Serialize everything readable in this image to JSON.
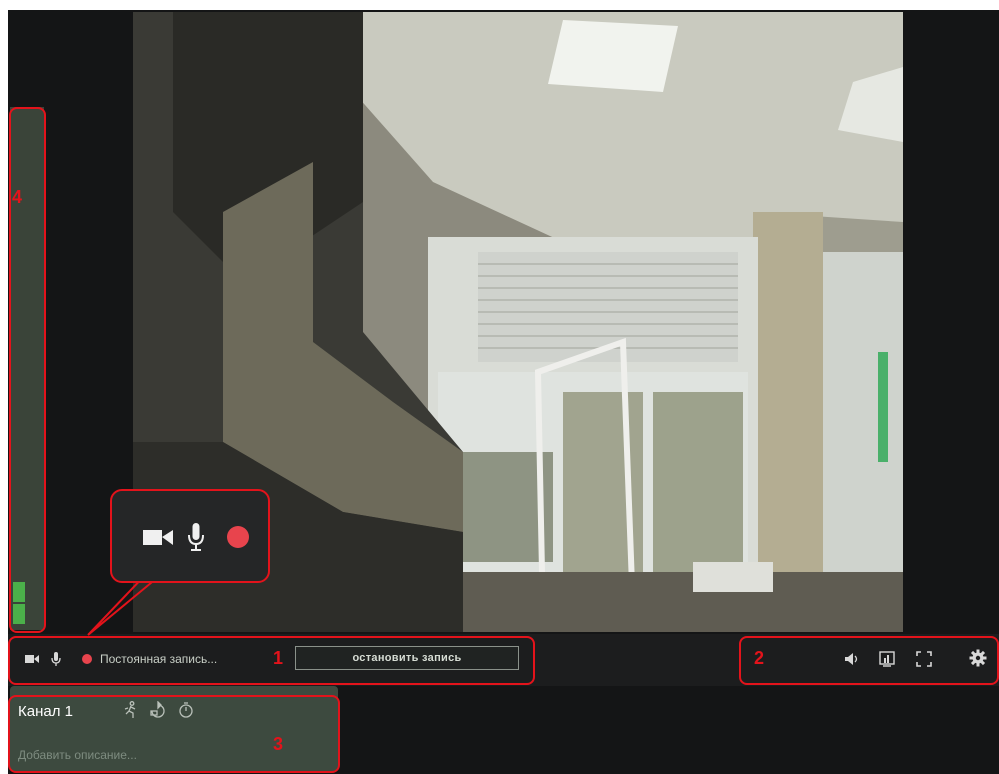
{
  "status": {
    "recording_text": "Постоянная запись...",
    "stop_button": "остановить запись"
  },
  "channel": {
    "title": "Канал 1",
    "description_placeholder": "Добавить описание..."
  },
  "annotations": {
    "n1": "1",
    "n2": "2",
    "n3": "3",
    "n4": "4"
  },
  "audio_level": 0.08,
  "icons": {
    "popup": [
      "camera-icon",
      "microphone-icon",
      "record-icon"
    ],
    "bar_left": [
      "camera-icon",
      "microphone-icon",
      "record-icon"
    ],
    "bar_right": [
      "volume-icon",
      "stats-icon",
      "fullscreen-icon",
      "settings-icon"
    ],
    "channel": [
      "motion-detector-icon",
      "ptz-icon",
      "timer-icon"
    ]
  },
  "colors": {
    "accent_red": "#e3131b",
    "record": "#e8444d",
    "meter_green": "#4bb04a",
    "panel": "#3d4a3f"
  }
}
